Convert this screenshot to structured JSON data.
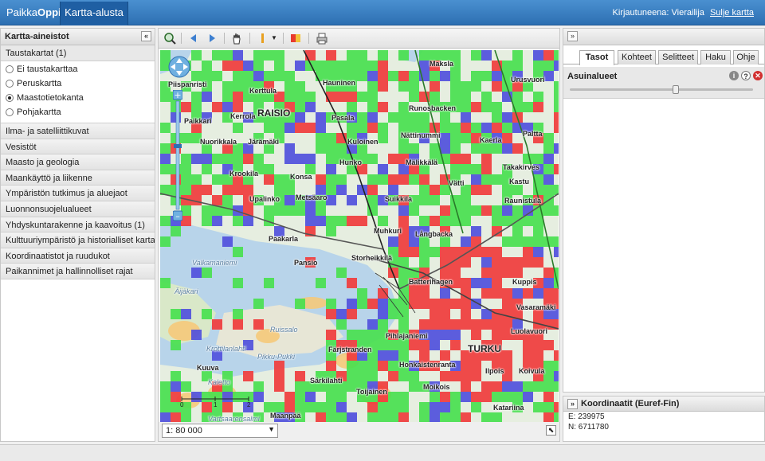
{
  "app": {
    "brand_prefix": "Paikka",
    "brand_suffix": "Oppi",
    "active_tab": "Kartta-alusta"
  },
  "login": {
    "label": "Kirjautuneena: Vierailija",
    "logout": "Sulje kartta"
  },
  "left_panel": {
    "title": "Kartta-aineistot",
    "collapse_glyph": "«",
    "open_section": "Taustakartat (1)",
    "basemaps": [
      {
        "label": "Ei taustakarttaa",
        "selected": false
      },
      {
        "label": "Peruskartta",
        "selected": false
      },
      {
        "label": "Maastotietokanta",
        "selected": true
      },
      {
        "label": "Pohjakartta",
        "selected": false
      }
    ],
    "sections": [
      "Ilma- ja satelliittikuvat",
      "Vesistöt",
      "Maasto ja geologia",
      "Maankäyttö ja liikenne",
      "Ympäristön tutkimus ja aluejaot",
      "Luonnonsuojelualueet",
      "Yhdyskuntarakenne ja kaavoitus (1)",
      "Kulttuuriympäristö ja historialliset kartat",
      "Koordinaatistot ja ruudukot",
      "Paikannimet ja hallinnolliset rajat"
    ]
  },
  "toolbar": {
    "icons": [
      "zoom-extent-icon",
      "back-arrow-icon",
      "forward-arrow-icon",
      "pan-hand-icon",
      "draw-tool-icon",
      "legend-icon",
      "print-icon"
    ]
  },
  "map": {
    "scale_value": "1: 80 000",
    "scale_ticks": [
      "0",
      "1",
      "2"
    ],
    "place_labels": [
      "Maksla",
      "Hauninen",
      "Urusvuori",
      "Kerttula",
      "RAISIO",
      "Pasala",
      "Runosbacken",
      "Paikkari",
      "Kerrola",
      "Piispanristi",
      "Nuorikkala",
      "Järämäki",
      "Kuloinen",
      "Nättinummi",
      "Kaerla",
      "Paltta",
      "Hunko",
      "Mälikkälä",
      "Takakirves",
      "Krookila",
      "Konsa",
      "Vätti",
      "Kastu",
      "Upalinko",
      "Metsäaro",
      "Suikkila",
      "Raunistula",
      "Muhkuri",
      "Långbacka",
      "Paakarla",
      "Pansio",
      "Storheikkilä",
      "Batterihagen",
      "Kuppis",
      "Vasaramäki",
      "Luolavuori",
      "Pihlajaniemi",
      "TURKU",
      "Färjstranden",
      "Kuuva",
      "Honkaistenranta",
      "Ilpois",
      "Koivula",
      "Särkilahti",
      "Toijainen",
      "Moikois",
      "Maanpää",
      "Katariina"
    ],
    "water_labels": [
      "Pikku-Pukki",
      "Ruissalo",
      "Kaletto",
      "Valkamaniemi",
      "Äijäkari",
      "Krottilanlahti",
      "Vartsaarensalmi"
    ]
  },
  "right_panel": {
    "collapse_glyph": "»",
    "tabs": [
      {
        "label": "Tasot",
        "active": true
      },
      {
        "label": "Kohteet",
        "active": false
      },
      {
        "label": "Selitteet",
        "active": false
      },
      {
        "label": "Haku",
        "active": false
      },
      {
        "label": "Ohje",
        "active": false
      }
    ],
    "layer": {
      "name": "Asuinalueet",
      "opacity": 0.58,
      "info_glyph": "i",
      "help_glyph": "?",
      "remove_glyph": "✕"
    }
  },
  "coordinates": {
    "title": "Koordinaatit (Euref-Fin)",
    "collapse_glyph": "»",
    "e": "E: 239975",
    "n": "N: 6711780"
  },
  "colors": {
    "accent": "#2d6fb2",
    "residential_red": "#f03c3c",
    "residential_green": "#49e04f",
    "residential_blue": "#5050dc"
  }
}
